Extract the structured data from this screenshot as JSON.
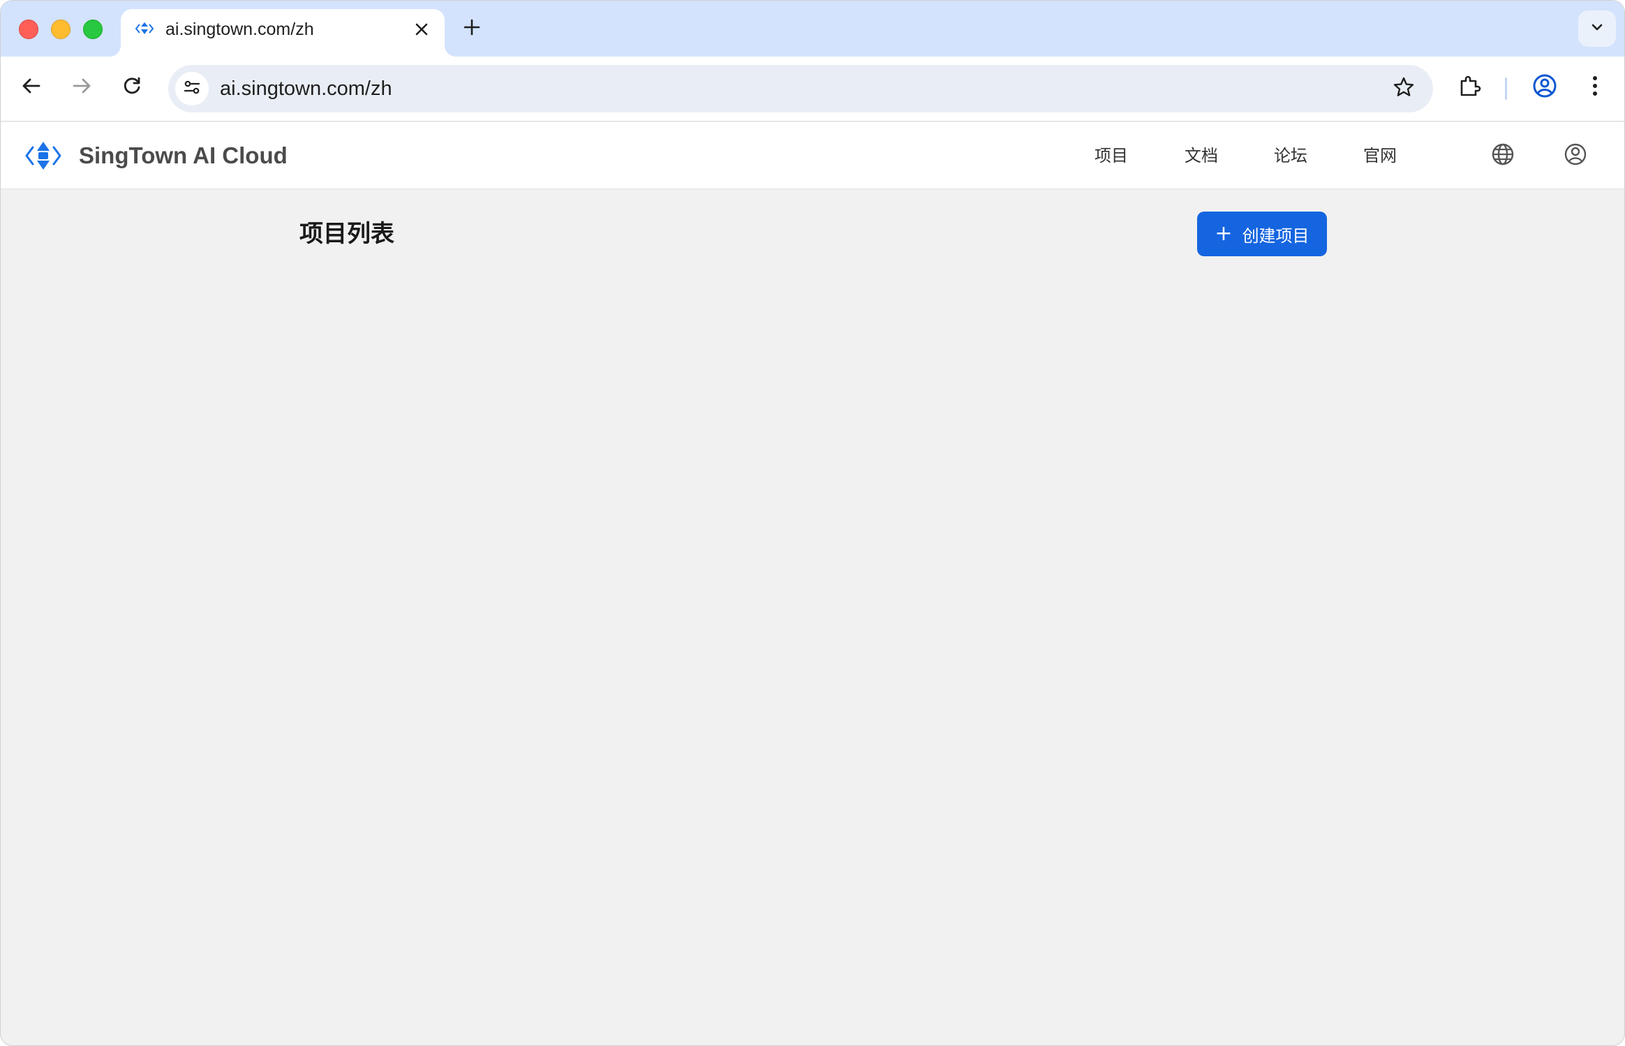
{
  "browser": {
    "tab": {
      "title": "ai.singtown.com/zh",
      "favicon": "singtown-favicon-icon"
    },
    "url": "ai.singtown.com/zh",
    "icons": [
      "back-icon",
      "forward-icon",
      "reload-icon",
      "tune-icon",
      "star-icon",
      "extensions-icon",
      "profile-icon",
      "more-icon",
      "close-icon",
      "plus-icon",
      "chevron-down-icon"
    ]
  },
  "header": {
    "brand": "SingTown AI Cloud",
    "nav": [
      {
        "label": "项目"
      },
      {
        "label": "文档"
      },
      {
        "label": "论坛"
      },
      {
        "label": "官网"
      }
    ],
    "icons": [
      "globe-icon",
      "account-icon"
    ]
  },
  "main": {
    "title": "项目列表",
    "create_button": {
      "icon": "+",
      "label": "创建项目"
    }
  },
  "colors": {
    "accent": "#1565e0",
    "tabstrip": "#d3e3fd",
    "page_bg": "#f1f1f1"
  }
}
